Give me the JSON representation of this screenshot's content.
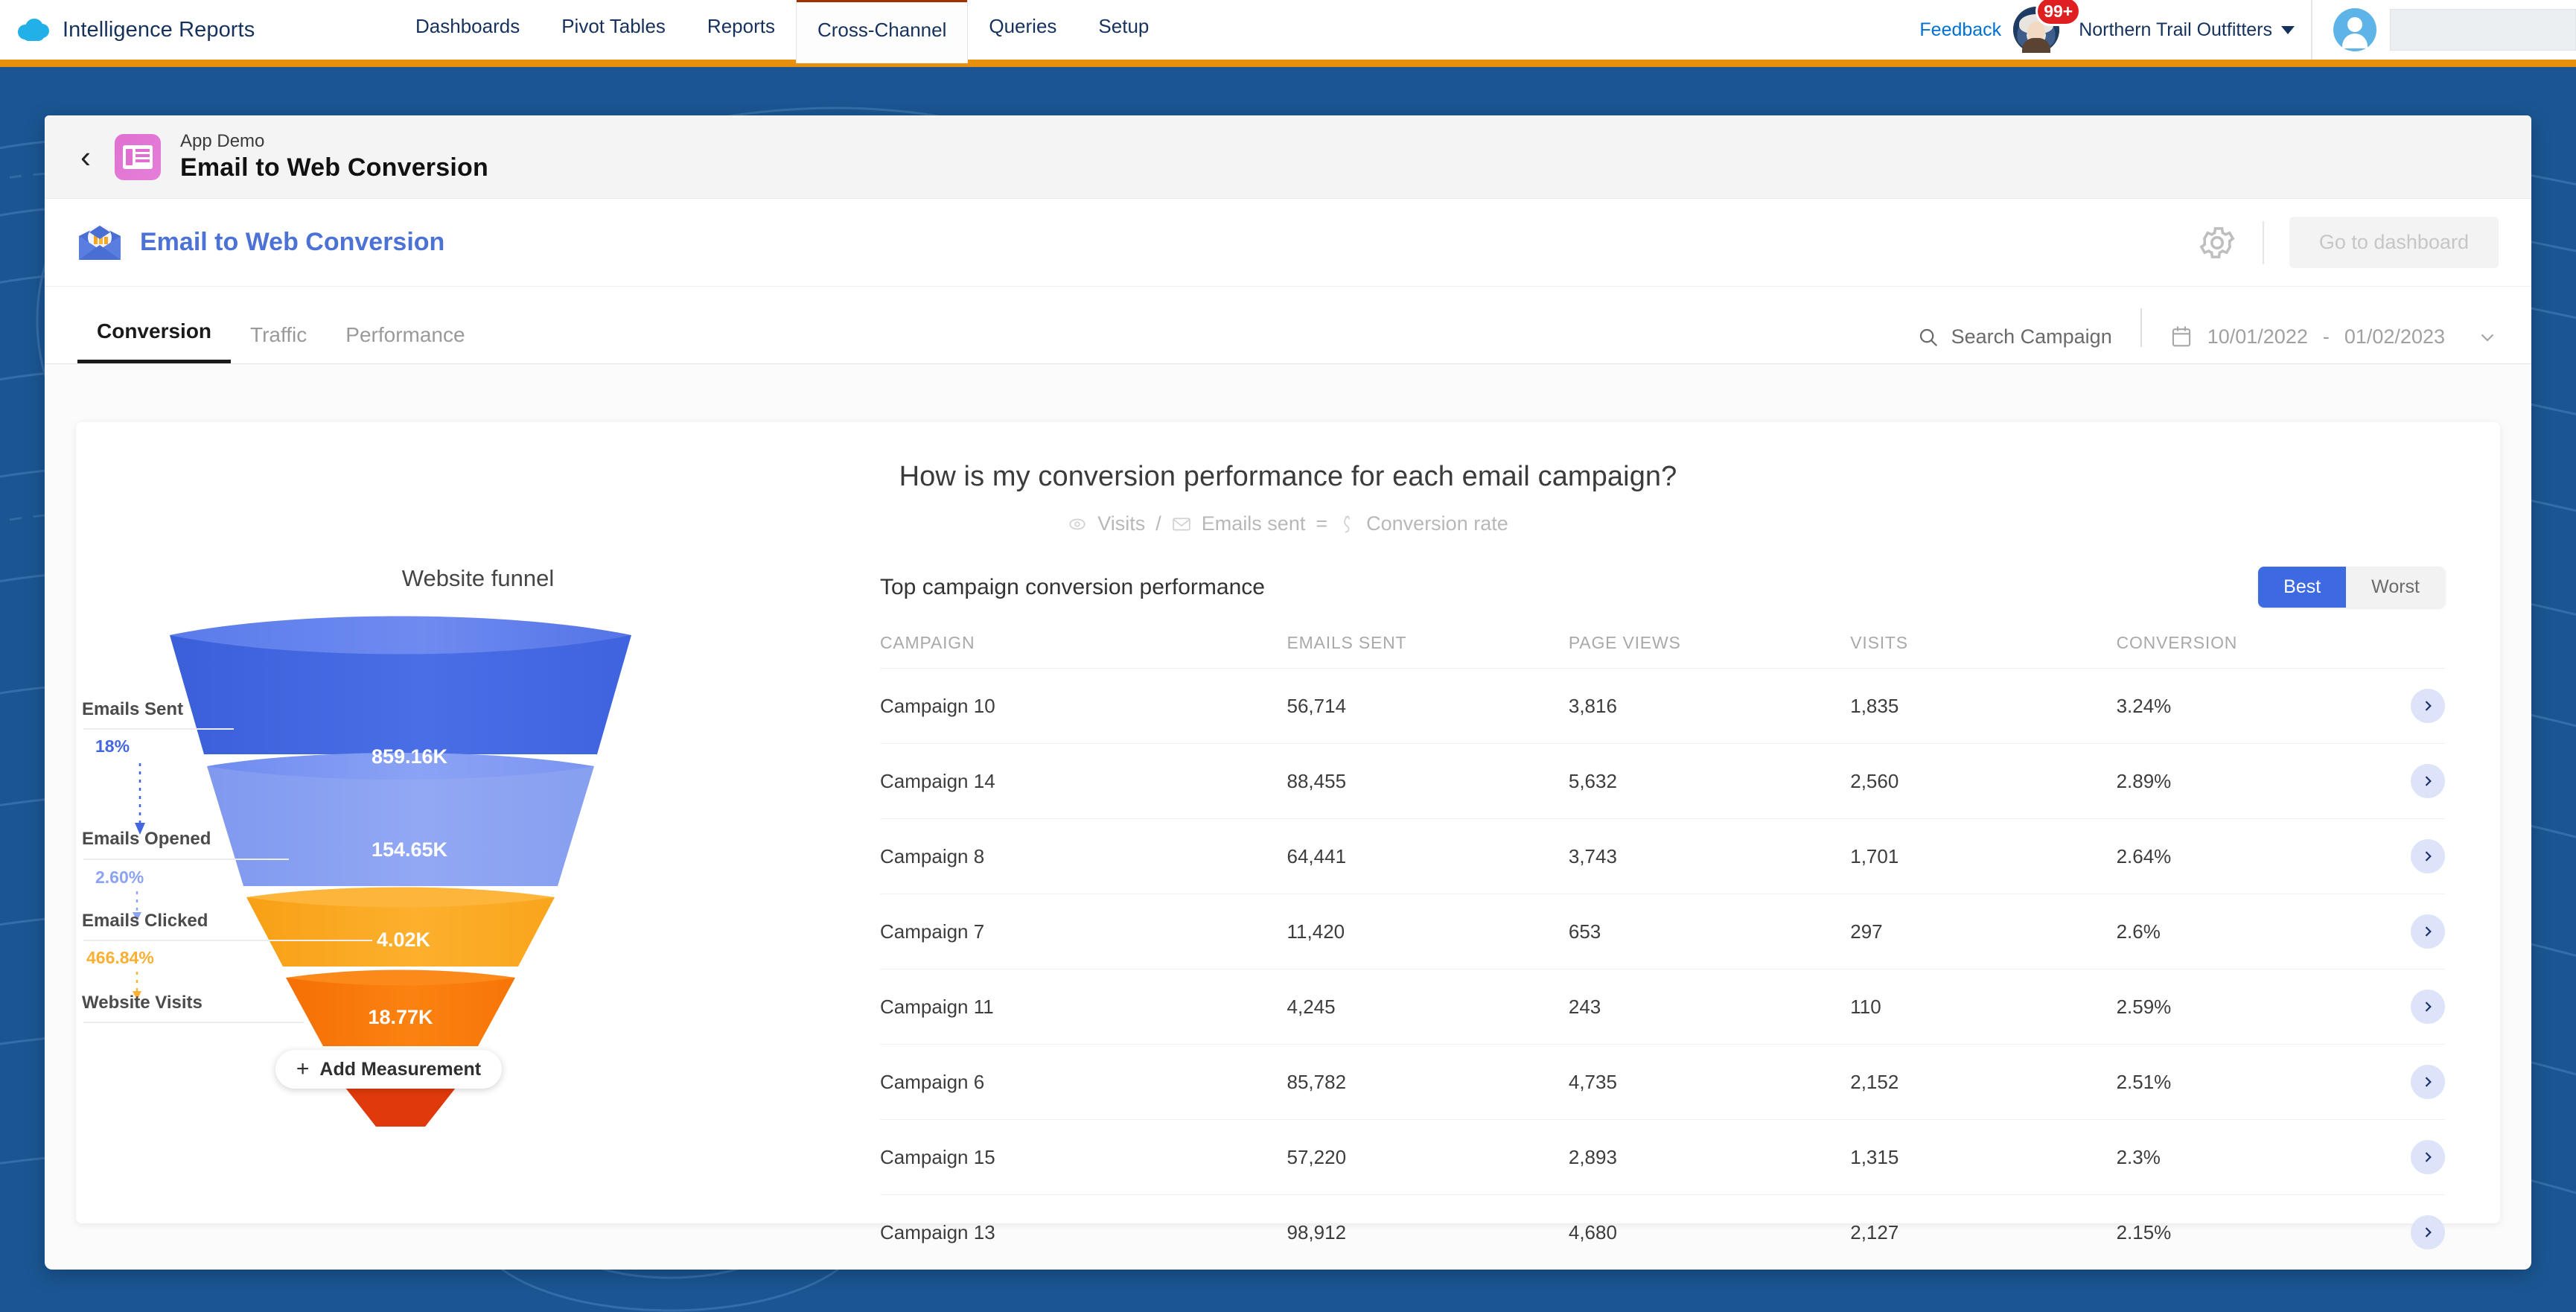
{
  "topnav": {
    "brand": "Intelligence Reports",
    "brand_logo_icon": "salesforce-cloud-icon",
    "items": [
      {
        "label": "Dashboards",
        "active": false
      },
      {
        "label": "Pivot Tables",
        "active": false
      },
      {
        "label": "Reports",
        "active": false
      },
      {
        "label": "Cross-Channel",
        "active": true
      },
      {
        "label": "Queries",
        "active": false
      },
      {
        "label": "Setup",
        "active": false
      }
    ],
    "feedback_label": "Feedback",
    "einstein_icon": "einstein-assistant-icon",
    "notification_badge": "99+",
    "org_name": "Northern Trail Outfitters",
    "org_caret_icon": "caret-down-icon",
    "avatar_icon": "user-avatar-icon"
  },
  "panel_head": {
    "back_icon": "chevron-left-icon",
    "app_icon": "report-app-icon",
    "subtitle": "App Demo",
    "title": "Email to Web Conversion"
  },
  "report_head": {
    "icon": "email-chart-icon",
    "title": "Email to Web Conversion",
    "gear_icon": "gear-icon",
    "go_to_dashboard_label": "Go to dashboard"
  },
  "tabs": {
    "items": [
      {
        "label": "Conversion",
        "active": true
      },
      {
        "label": "Traffic",
        "active": false
      },
      {
        "label": "Performance",
        "active": false
      }
    ],
    "search_icon": "search-icon",
    "search_label": "Search Campaign",
    "calendar_icon": "calendar-icon",
    "date_start": "10/01/2022",
    "date_separator": "-",
    "date_end": "01/02/2023",
    "date_caret_icon": "chevron-down-icon"
  },
  "content": {
    "question": "How is my conversion performance for each email campaign?",
    "formula": {
      "visits_icon": "eye-icon",
      "visits": "Visits",
      "divider": "/",
      "emails_icon": "envelope-icon",
      "emails_sent": "Emails sent",
      "equals": "=",
      "rate_icon": "conversion-icon",
      "conversion_rate": "Conversion rate"
    },
    "funnel_title": "Website funnel",
    "add_measurement_label": "Add Measurement",
    "add_measurement_icon": "plus-icon",
    "table_title": "Top campaign conversion performance",
    "toggle": {
      "best": "Best",
      "worst": "Worst",
      "selected": "Best"
    },
    "row_action_icon": "chevron-right-icon"
  },
  "chart_data": {
    "type": "funnel",
    "title": "Website funnel",
    "stages": [
      {
        "label": "Emails Sent",
        "value_label": "859.16K",
        "value": 859160,
        "color": "#4367e0"
      },
      {
        "label": "Emails Opened",
        "value_label": "154.65K",
        "value": 154650,
        "color": "#8ba3f0"
      },
      {
        "label": "Emails Clicked",
        "value_label": "4.02K",
        "value": 4020,
        "color": "#fba61a"
      },
      {
        "label": "Website Visits",
        "value_label": "18.77K",
        "value": 18770,
        "color": "#f97509"
      }
    ],
    "transitions": [
      {
        "from": "Emails Sent",
        "to": "Emails Opened",
        "label": "18%",
        "color": "#4367e0"
      },
      {
        "from": "Emails Opened",
        "to": "Emails Clicked",
        "label": "2.60%",
        "color": "#8ba3f0"
      },
      {
        "from": "Emails Clicked",
        "to": "Website Visits",
        "label": "466.84%",
        "color": "#fbb034"
      }
    ]
  },
  "table": {
    "columns": [
      "CAMPAIGN",
      "EMAILS SENT",
      "PAGE VIEWS",
      "VISITS",
      "CONVERSION"
    ],
    "rows": [
      {
        "campaign": "Campaign 10",
        "emails_sent": "56,714",
        "page_views": "3,816",
        "visits": "1,835",
        "conversion": "3.24%"
      },
      {
        "campaign": "Campaign 14",
        "emails_sent": "88,455",
        "page_views": "5,632",
        "visits": "2,560",
        "conversion": "2.89%"
      },
      {
        "campaign": "Campaign 8",
        "emails_sent": "64,441",
        "page_views": "3,743",
        "visits": "1,701",
        "conversion": "2.64%"
      },
      {
        "campaign": "Campaign 7",
        "emails_sent": "11,420",
        "page_views": "653",
        "visits": "297",
        "conversion": "2.6%"
      },
      {
        "campaign": "Campaign 11",
        "emails_sent": "4,245",
        "page_views": "243",
        "visits": "110",
        "conversion": "2.59%"
      },
      {
        "campaign": "Campaign 6",
        "emails_sent": "85,782",
        "page_views": "4,735",
        "visits": "2,152",
        "conversion": "2.51%"
      },
      {
        "campaign": "Campaign 15",
        "emails_sent": "57,220",
        "page_views": "2,893",
        "visits": "1,315",
        "conversion": "2.3%"
      },
      {
        "campaign": "Campaign 13",
        "emails_sent": "98,912",
        "page_views": "4,680",
        "visits": "2,127",
        "conversion": "2.15%"
      }
    ]
  },
  "colors": {
    "nav_orange": "#e8900c",
    "active_tab_bar": "#a03000",
    "page_bg_blue": "#1b5693",
    "accent_blue": "#3e6ae1",
    "link_blue": "#0070d2",
    "badge_red": "#e02020"
  }
}
